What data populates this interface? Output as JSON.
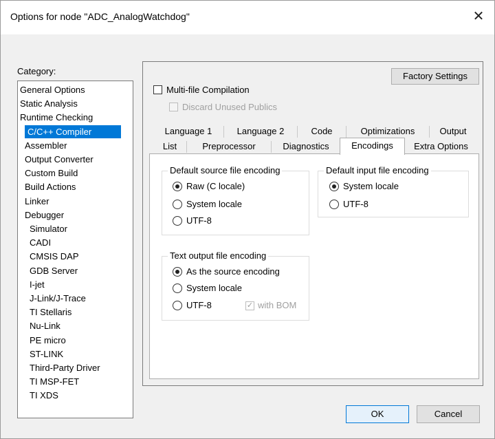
{
  "window": {
    "title": "Options for node \"ADC_AnalogWatchdog\"",
    "close_glyph": "✕"
  },
  "category_label": "Category:",
  "categories": [
    {
      "label": "General Options",
      "indent": 0
    },
    {
      "label": "Static Analysis",
      "indent": 0
    },
    {
      "label": "Runtime Checking",
      "indent": 0
    },
    {
      "label": "C/C++ Compiler",
      "indent": 1,
      "selected": true
    },
    {
      "label": "Assembler",
      "indent": 1
    },
    {
      "label": "Output Converter",
      "indent": 1
    },
    {
      "label": "Custom Build",
      "indent": 1
    },
    {
      "label": "Build Actions",
      "indent": 1
    },
    {
      "label": "Linker",
      "indent": 1
    },
    {
      "label": "Debugger",
      "indent": 1
    },
    {
      "label": "Simulator",
      "indent": 2
    },
    {
      "label": "CADI",
      "indent": 2
    },
    {
      "label": "CMSIS DAP",
      "indent": 2
    },
    {
      "label": "GDB Server",
      "indent": 2
    },
    {
      "label": "I-jet",
      "indent": 2
    },
    {
      "label": "J-Link/J-Trace",
      "indent": 2
    },
    {
      "label": "TI Stellaris",
      "indent": 2
    },
    {
      "label": "Nu-Link",
      "indent": 2
    },
    {
      "label": "PE micro",
      "indent": 2
    },
    {
      "label": "ST-LINK",
      "indent": 2
    },
    {
      "label": "Third-Party Driver",
      "indent": 2
    },
    {
      "label": "TI MSP-FET",
      "indent": 2
    },
    {
      "label": "TI XDS",
      "indent": 2
    }
  ],
  "factory_settings": "Factory Settings",
  "multi_file": "Multi-file Compilation",
  "discard_unused": "Discard Unused Publics",
  "tabs_row1": [
    "Language 1",
    "Language 2",
    "Code",
    "Optimizations",
    "Output"
  ],
  "tabs_row2": [
    "List",
    "Preprocessor",
    "Diagnostics",
    "Encodings",
    "Extra Options"
  ],
  "active_tab": "Encodings",
  "src_group": {
    "title": "Default source file encoding",
    "options": [
      "Raw (C locale)",
      "System locale",
      "UTF-8"
    ],
    "selected": "Raw (C locale)"
  },
  "input_group": {
    "title": "Default input file encoding",
    "options": [
      "System locale",
      "UTF-8"
    ],
    "selected": "System locale"
  },
  "output_group": {
    "title": "Text output file encoding",
    "options": [
      "As the source encoding",
      "System locale",
      "UTF-8"
    ],
    "selected": "As the source encoding",
    "with_bom": "with BOM"
  },
  "ok": "OK",
  "cancel": "Cancel"
}
